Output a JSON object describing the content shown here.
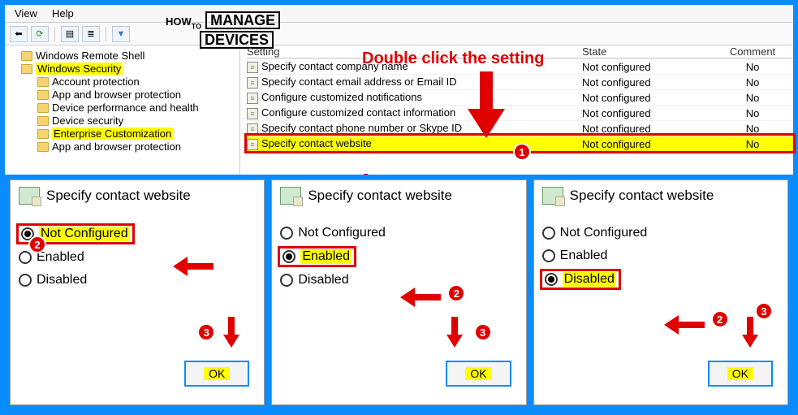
{
  "menu": {
    "view": "View",
    "help": "Help"
  },
  "logo": {
    "how": "HOW",
    "to": "TO",
    "manage": "MANAGE",
    "devices": "DEVICES"
  },
  "tree": {
    "items": [
      {
        "label": "Windows Remote Shell",
        "lvl": 1,
        "hl": false
      },
      {
        "label": "Windows Security",
        "lvl": 1,
        "hl": true
      },
      {
        "label": "Account protection",
        "lvl": 2,
        "hl": false
      },
      {
        "label": "App and browser protection",
        "lvl": 2,
        "hl": false
      },
      {
        "label": "Device performance and health",
        "lvl": 2,
        "hl": false
      },
      {
        "label": "Device security",
        "lvl": 2,
        "hl": false
      },
      {
        "label": "Enterprise Customization",
        "lvl": 2,
        "hl": true
      },
      {
        "label": "App and browser protection",
        "lvl": 2,
        "hl": false
      }
    ]
  },
  "list": {
    "cols": {
      "setting": "Setting",
      "state": "State",
      "comment": "Comment"
    },
    "rows": [
      {
        "setting": "Specify contact company name",
        "state": "Not configured",
        "comment": "No"
      },
      {
        "setting": "Specify contact email address or Email ID",
        "state": "Not configured",
        "comment": "No"
      },
      {
        "setting": "Configure customized notifications",
        "state": "Not configured",
        "comment": "No"
      },
      {
        "setting": "Configure customized contact information",
        "state": "Not configured",
        "comment": "No"
      },
      {
        "setting": "Specify contact phone number or Skype ID",
        "state": "Not configured",
        "comment": "No"
      },
      {
        "setting": "Specify contact website",
        "state": "Not configured",
        "comment": "No",
        "hl": true
      }
    ]
  },
  "annotation": {
    "title": "Double click the setting"
  },
  "panels": {
    "title": "Specify contact website",
    "opts": {
      "nc": "Not Configured",
      "en": "Enabled",
      "dis": "Disabled"
    },
    "ok": "OK",
    "badges": {
      "one": "1",
      "two": "2",
      "three": "3"
    }
  }
}
